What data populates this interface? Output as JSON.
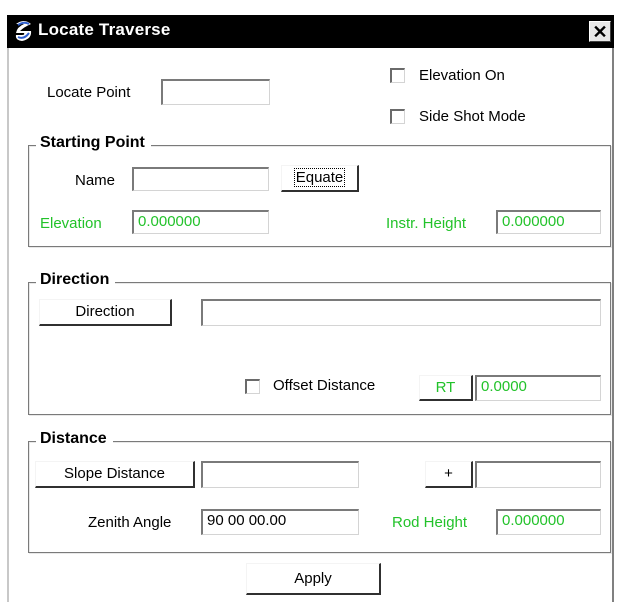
{
  "window": {
    "title": "Locate Traverse",
    "close_symbol": "✕"
  },
  "locate_point": {
    "label": "Locate Point",
    "value": ""
  },
  "options": {
    "elevation_on": {
      "label": "Elevation On",
      "checked": false
    },
    "side_shot_mode": {
      "label": "Side Shot Mode",
      "checked": false
    }
  },
  "starting_point": {
    "title": "Starting Point",
    "name_label": "Name",
    "name_value": "",
    "equate_label": "Equate",
    "elevation_label": "Elevation",
    "elevation_value": "0.000000",
    "instr_height_label": "Instr. Height",
    "instr_height_value": "0.000000"
  },
  "direction": {
    "title": "Direction",
    "direction_button": "Direction",
    "direction_value": "",
    "offset_label": "Offset Distance",
    "offset_checked": false,
    "side_button": "RT",
    "offset_value": "0.0000"
  },
  "distance": {
    "title": "Distance",
    "slope_button": "Slope Distance",
    "slope_value": "",
    "plus_button": "+",
    "plus_value": "",
    "zenith_label": "Zenith Angle",
    "zenith_value": "90 00 00.00",
    "rod_height_label": "Rod Height",
    "rod_height_value": "0.000000"
  },
  "apply_label": "Apply",
  "colors": {
    "accent_green": "#22c22a",
    "titlebar": "#000000"
  }
}
